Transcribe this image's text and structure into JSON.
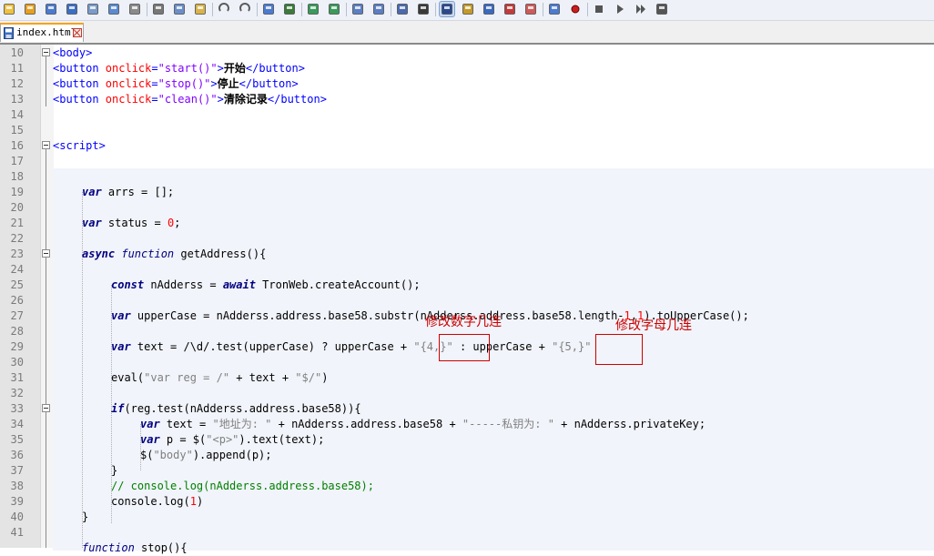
{
  "toolbar": {
    "icons": [
      "new-file-icon",
      "open-file-icon",
      "save-icon",
      "save-all-icon",
      "close-icon",
      "close-all-icon",
      "print-icon",
      "cut-icon",
      "copy-icon",
      "paste-icon",
      "undo-icon",
      "redo-icon",
      "find-icon",
      "replace-icon",
      "zoom-in-icon",
      "zoom-out-icon",
      "sync-vertical-icon",
      "sync-horizontal-icon",
      "word-wrap-icon",
      "show-all-chars-icon",
      "indent-guide-icon",
      "user-language-icon",
      "document-map-icon",
      "function-list-icon",
      "folder-workspace-icon",
      "monitoring-icon",
      "record-macro-icon",
      "stop-recording-icon",
      "play-macro-icon",
      "run-macro-multiple-icon",
      "save-macro-icon"
    ]
  },
  "tab": {
    "label": "index.html"
  },
  "editor": {
    "lines": [
      {
        "n": "10"
      },
      {
        "n": "11"
      },
      {
        "n": "12"
      },
      {
        "n": "13"
      },
      {
        "n": "14"
      },
      {
        "n": "15"
      },
      {
        "n": "16"
      },
      {
        "n": "17"
      },
      {
        "n": "18"
      },
      {
        "n": "19"
      },
      {
        "n": "20"
      },
      {
        "n": "21"
      },
      {
        "n": "22"
      },
      {
        "n": "23"
      },
      {
        "n": "24"
      },
      {
        "n": "25"
      },
      {
        "n": "26"
      },
      {
        "n": "27"
      },
      {
        "n": "28"
      },
      {
        "n": "29"
      },
      {
        "n": "30"
      },
      {
        "n": "31"
      },
      {
        "n": "32"
      },
      {
        "n": "33"
      },
      {
        "n": "34"
      },
      {
        "n": "35"
      },
      {
        "n": "36"
      },
      {
        "n": "37"
      },
      {
        "n": "38"
      },
      {
        "n": "39"
      },
      {
        "n": "40"
      },
      {
        "n": "41"
      }
    ],
    "code": {
      "l10": "<body>",
      "l11_open": "<button ",
      "l11_attr": "onclick",
      "l11_eq": "=",
      "l11_val": "\"start()\"",
      "l11_gt": ">",
      "l11_txt": "开始",
      "l11_close": "</button>",
      "l12_open": "<button ",
      "l12_attr": "onclick",
      "l12_eq": "=",
      "l12_val": "\"stop()\"",
      "l12_gt": ">",
      "l12_txt": "停止",
      "l12_close": "</button>",
      "l13_open": "<button ",
      "l13_attr": "onclick",
      "l13_eq": "=",
      "l13_val": "\"clean()\"",
      "l13_gt": ">",
      "l13_txt": "清除记录",
      "l13_close": "</button>",
      "l16": "<script>",
      "l19_kw": "var",
      "l19_rest": " arrs = [];",
      "l21_kw": "var",
      "l21_rest": " status = ",
      "l21_num": "0",
      "l21_end": ";",
      "l23_kw1": "async",
      "l23_kw2": "function",
      "l23_rest": " getAddress(){",
      "l25_kw1": "const",
      "l25_mid": " nAdderss = ",
      "l25_kw2": "await",
      "l25_rest": " TronWeb.createAccount();",
      "l27_kw": "var",
      "l27_a": " upperCase = nAdderss.address.base58.substr(nAdderss.address.base58.length-",
      "l27_num": "1",
      "l27_c": ",",
      "l27_num2": "1",
      "l27_d": ").toUpperCase();",
      "l29_kw": "var",
      "l29_a": " text = ",
      "l29_re": "/\\d/",
      "l29_b": ".test(upperCase) ? upperCase + ",
      "l29_s1": "\"{4,}\"",
      "l29_c": " : upperCase + ",
      "l29_s2": "\"{5,}\"",
      "l31_a": "eval(",
      "l31_s1": "\"var reg = /\"",
      "l31_b": " + text + ",
      "l31_s2": "\"$/\"",
      "l31_c": ")",
      "l33_kw": "if",
      "l33_rest": "(reg.test(nAdderss.address.base58)){",
      "l34_kw": "var",
      "l34_a": " text = ",
      "l34_s1": "\"地址为: \"",
      "l34_b": " + nAdderss.address.base58 + ",
      "l34_s2": "\"-----私钥为: \"",
      "l34_c": " + nAdderss.privateKey;",
      "l35_kw": "var",
      "l35_a": " p = $(",
      "l35_s": "\"<p>\"",
      "l35_b": ").text(text);",
      "l36_a": "$(",
      "l36_s": "\"body\"",
      "l36_b": ").append(p);",
      "l37": "}",
      "l38": "// console.log(nAdderss.address.base58);",
      "l39_a": "console.log(",
      "l39_num": "1",
      "l39_b": ")",
      "l40": "}",
      "l42_kw": "function",
      "l42_rest": " stop(){"
    }
  },
  "annotations": {
    "digits": "修改数字几连",
    "letters": "修改字母几连"
  },
  "colors": {
    "tag": "#0000ff",
    "attr": "#ff0000",
    "string": "#8000ff",
    "keyword": "#000080",
    "comment": "#008000",
    "annotation": "#cc0000"
  }
}
